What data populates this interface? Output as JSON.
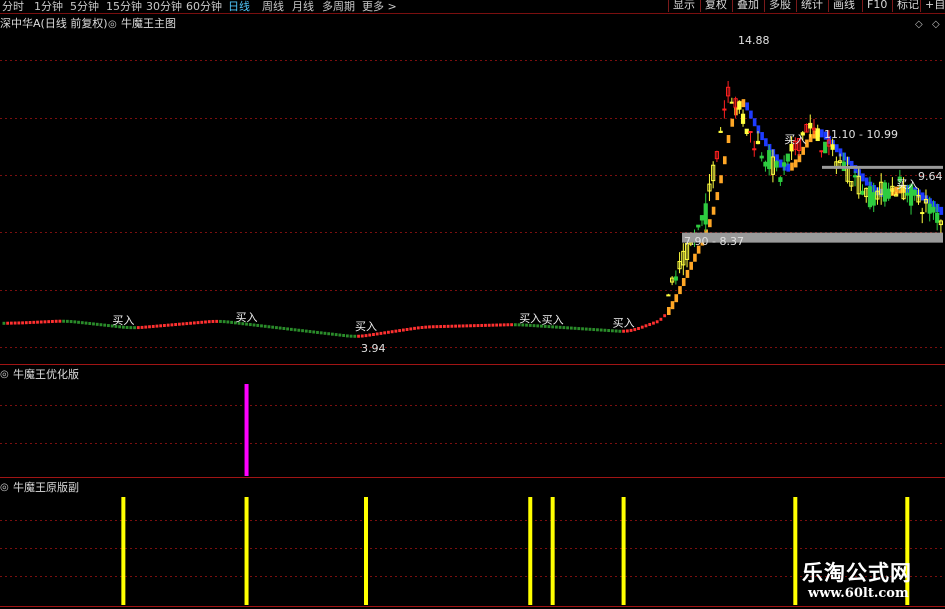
{
  "toolbar": {
    "periods": [
      "分时",
      "1分钟",
      "5分钟",
      "15分钟",
      "30分钟",
      "60分钟",
      "日线",
      "周线",
      "月线",
      "多周期",
      "更多 >"
    ],
    "active_period": "日线",
    "right_buttons": [
      "显示",
      "复权",
      "叠加",
      "多股",
      "统计",
      "画线",
      "F10",
      "标记",
      "+自选"
    ]
  },
  "main_panel": {
    "stock_label": "深中华A(日线 前复权)",
    "indicator_label": "牛魔王主图",
    "max_label": "14.88",
    "min_label": "3.94",
    "resistance_label": "11.10 - 10.99",
    "support_label": "7.90 - 8.37",
    "recent_label": "9.64 -",
    "buy_text": "买入"
  },
  "panel2": {
    "title": "牛魔王优化版"
  },
  "panel3": {
    "title": "牛魔王原版副"
  },
  "watermark": {
    "line1": "乐淘公式网",
    "line2": "www.60lt.com"
  },
  "colors": {
    "up": "#ff3c3c",
    "down": "#2ecc40",
    "trend_up": "#ffa726",
    "trend_down": "#1e3cff",
    "yellow": "#ffff00",
    "magenta": "#ff00ff",
    "grid": "#7a0f0f"
  },
  "chart_data": {
    "type": "candlestick",
    "price_range": [
      3.0,
      16.0
    ],
    "overall_low": 3.94,
    "overall_high": 14.88,
    "price_levels": [
      {
        "label": "11.10 - 10.99",
        "low": 10.99,
        "high": 11.1
      },
      {
        "label": "7.90 - 8.37",
        "low": 7.9,
        "high": 8.37
      }
    ],
    "buy_signals": [
      {
        "bar": 32,
        "label": "买入"
      },
      {
        "bar": 65,
        "label": "买入"
      },
      {
        "bar": 97,
        "label": "买入"
      },
      {
        "bar": 141,
        "label": "买入"
      },
      {
        "bar": 147,
        "label": "买入"
      },
      {
        "bar": 166,
        "label": "买入"
      },
      {
        "bar": 212,
        "label": "买入"
      },
      {
        "bar": 242,
        "label": "买入"
      }
    ],
    "price_segments": [
      {
        "from_bar": 0,
        "to_bar": 14,
        "start": 4.5,
        "end": 4.6
      },
      {
        "from_bar": 14,
        "to_bar": 32,
        "start": 4.6,
        "end": 4.3
      },
      {
        "from_bar": 32,
        "to_bar": 55,
        "start": 4.3,
        "end": 4.6
      },
      {
        "from_bar": 55,
        "to_bar": 92,
        "start": 4.6,
        "end": 3.94
      },
      {
        "from_bar": 92,
        "to_bar": 110,
        "start": 3.94,
        "end": 4.35
      },
      {
        "from_bar": 110,
        "to_bar": 135,
        "start": 4.35,
        "end": 4.45
      },
      {
        "from_bar": 135,
        "to_bar": 165,
        "start": 4.45,
        "end": 4.15
      },
      {
        "from_bar": 165,
        "to_bar": 175,
        "start": 4.15,
        "end": 4.7
      },
      {
        "from_bar": 175,
        "to_bar": 188,
        "start": 4.7,
        "end": 9.0
      },
      {
        "from_bar": 188,
        "to_bar": 194,
        "start": 9.0,
        "end": 14.2
      },
      {
        "from_bar": 194,
        "to_bar": 200,
        "start": 14.2,
        "end": 12.2
      },
      {
        "from_bar": 200,
        "to_bar": 208,
        "start": 12.2,
        "end": 10.5
      },
      {
        "from_bar": 208,
        "to_bar": 215,
        "start": 10.5,
        "end": 12.6
      },
      {
        "from_bar": 215,
        "to_bar": 222,
        "start": 12.6,
        "end": 11.4
      },
      {
        "from_bar": 222,
        "to_bar": 232,
        "start": 11.4,
        "end": 9.7
      },
      {
        "from_bar": 232,
        "to_bar": 240,
        "start": 9.7,
        "end": 10.1
      },
      {
        "from_bar": 240,
        "to_bar": 251,
        "start": 10.1,
        "end": 8.8
      }
    ],
    "panel2_bars": [
      {
        "bar": 65,
        "height": 1.0
      }
    ],
    "panel3_bars": [
      32,
      65,
      97,
      141,
      147,
      166,
      212,
      242
    ]
  }
}
